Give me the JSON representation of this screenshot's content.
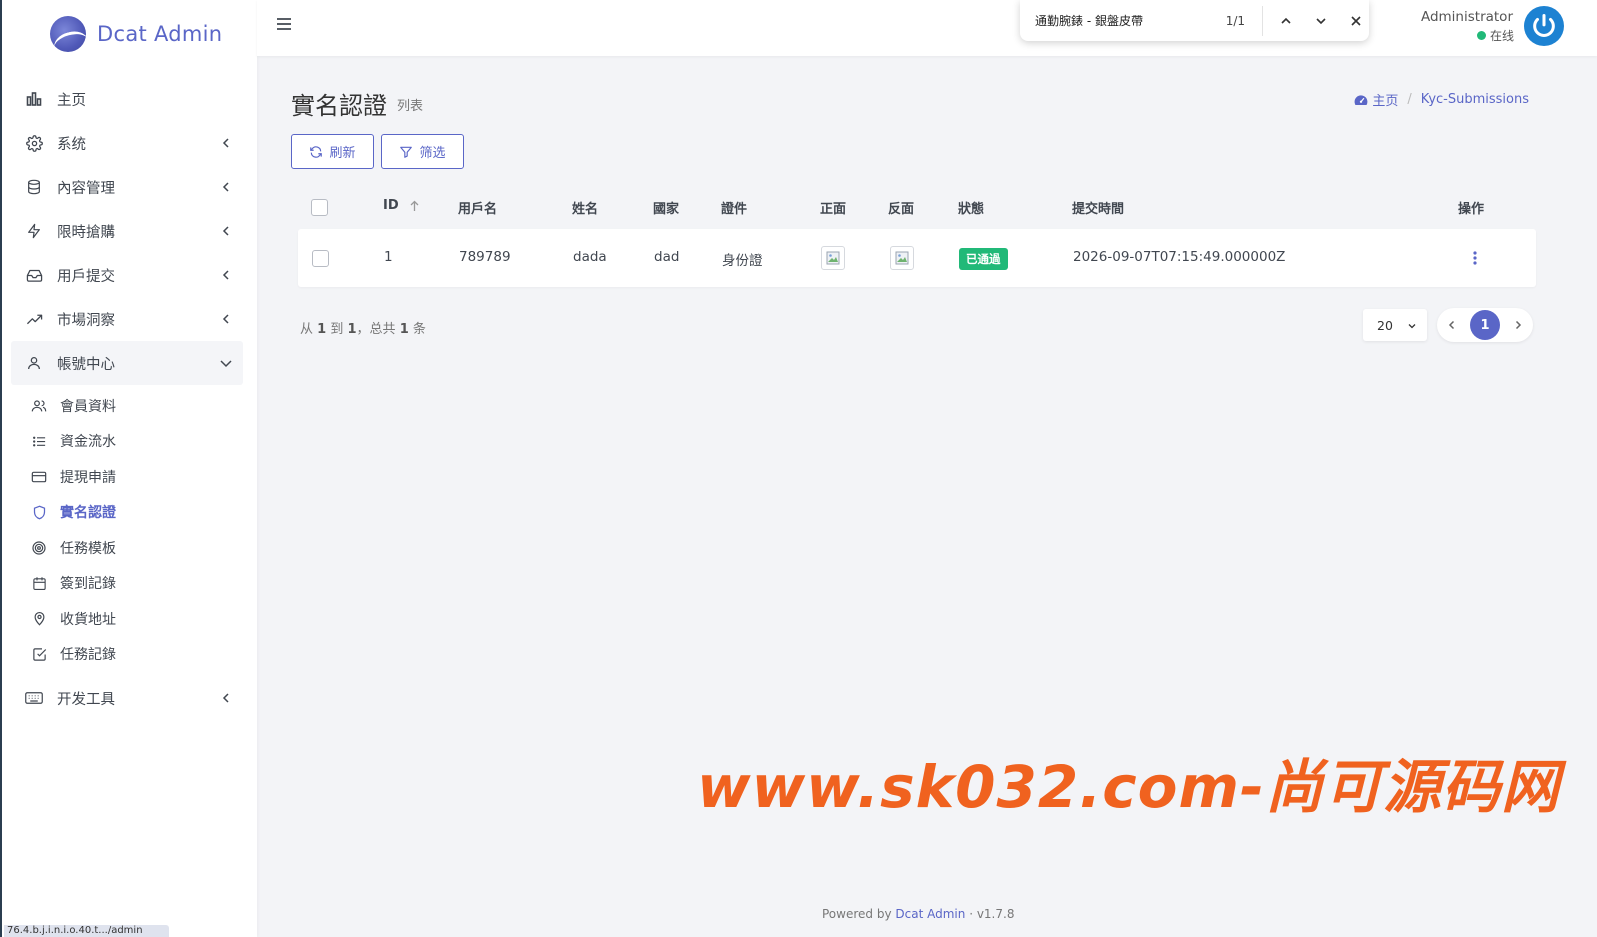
{
  "brand": {
    "name": "Dcat Admin"
  },
  "sidebar": {
    "items": [
      {
        "label": "主页"
      },
      {
        "label": "系统"
      },
      {
        "label": "內容管理"
      },
      {
        "label": "限時搶購"
      },
      {
        "label": "用戶提交"
      },
      {
        "label": "市場洞察"
      },
      {
        "label": "帳號中心"
      },
      {
        "label": "开发工具"
      }
    ],
    "sub_items": [
      {
        "label": "會員資料"
      },
      {
        "label": "資金流水"
      },
      {
        "label": "提現申請"
      },
      {
        "label": "實名認證"
      },
      {
        "label": "任務模板"
      },
      {
        "label": "簽到記錄"
      },
      {
        "label": "收貨地址"
      },
      {
        "label": "任務記錄"
      }
    ],
    "status_url": "76.4.b.j.i.n.i.o.40.t.../admin"
  },
  "findbar": {
    "query": "通勤腕錶 - 銀盤皮帶",
    "count": "1/1"
  },
  "user": {
    "name": "Administrator",
    "status": "在线"
  },
  "page": {
    "title": "實名認證",
    "subtitle": "列表"
  },
  "breadcrumb": {
    "home": "主页",
    "current": "Kyc-Submissions"
  },
  "toolbar": {
    "refresh": "刷新",
    "filter": "筛选"
  },
  "table": {
    "headers": {
      "id": "ID",
      "username": "用戶名",
      "name": "姓名",
      "country": "國家",
      "doc": "證件",
      "front": "正面",
      "back": "反面",
      "status": "狀態",
      "submitted": "提交時間",
      "actions": "操作"
    },
    "rows": [
      {
        "id": "1",
        "username": "789789",
        "name": "dada",
        "country": "dad",
        "doc": "身份證",
        "status": "已通過",
        "submitted": "2026-09-07T07:15:49.000000Z"
      }
    ]
  },
  "pager": {
    "from_label": "从",
    "from": "1",
    "to_label": "到",
    "to": "1",
    "total_label": "，总共",
    "total": "1",
    "unit": "条",
    "per_page": "20",
    "current_page": "1"
  },
  "watermark": "www.sk032.com-尚可源码网",
  "footer": {
    "powered_by": "Powered by",
    "link": "Dcat Admin",
    "version": "· v1.7.8"
  },
  "colors": {
    "accent": "#5a66c7",
    "success": "#21b978",
    "watermark": "#f0621f"
  }
}
